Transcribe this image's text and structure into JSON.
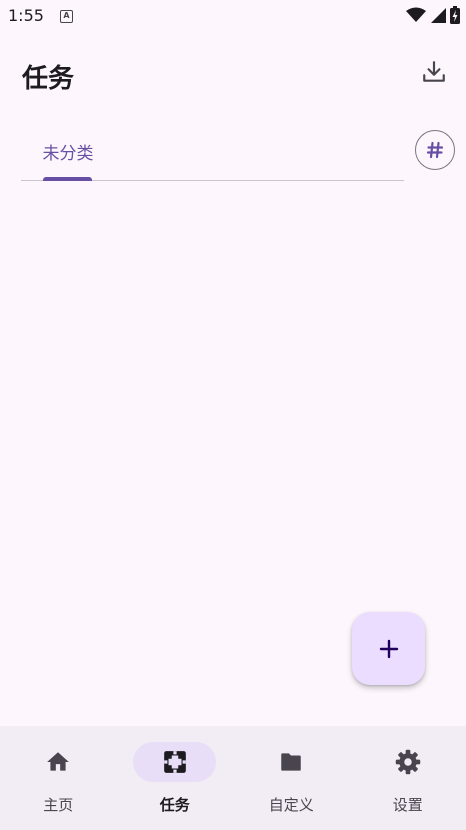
{
  "status_bar": {
    "time": "1:55",
    "notification_icon_letter": "A"
  },
  "header": {
    "title": "任务",
    "download_icon": "download-icon"
  },
  "tabs": [
    {
      "label": "未分类",
      "selected": true
    }
  ],
  "tab_action_icon": "hash-icon",
  "fab_icon": "plus-icon",
  "bottom_nav": [
    {
      "label": "主页",
      "icon": "home-icon",
      "active": false
    },
    {
      "label": "任务",
      "icon": "task-icon",
      "active": true
    },
    {
      "label": "自定义",
      "icon": "folder-icon",
      "active": false
    },
    {
      "label": "设置",
      "icon": "gear-icon",
      "active": false
    }
  ],
  "colors": {
    "primary": "#6750a4",
    "background": "#fdf7fd",
    "fab": "#eaddff",
    "nav_background": "#f2ecf4",
    "nav_active_pill": "#e8def8"
  }
}
